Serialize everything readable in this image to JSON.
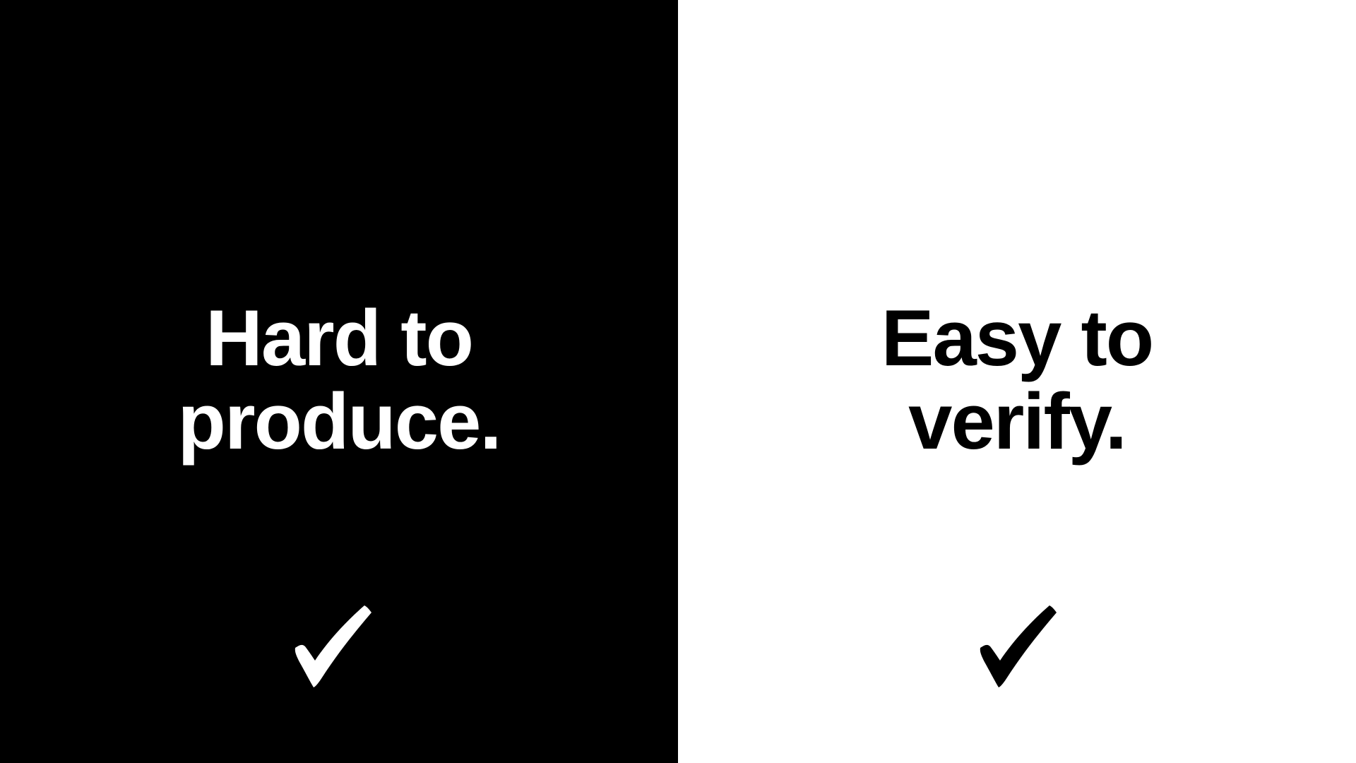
{
  "left_panel": {
    "line1": "Hard to",
    "line2": "produce.",
    "icon": "checkmark-icon",
    "background": "#000000",
    "text_color": "#ffffff"
  },
  "right_panel": {
    "line1": "Easy to",
    "line2": "verify.",
    "icon": "checkmark-icon",
    "background": "#ffffff",
    "text_color": "#000000"
  }
}
